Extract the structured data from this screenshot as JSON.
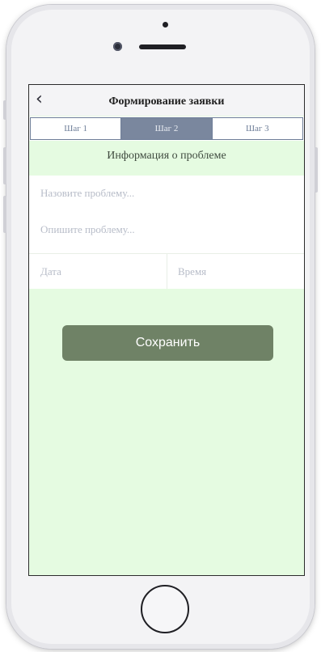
{
  "header": {
    "back_icon": "chevron-left-icon",
    "back_glyph": "‹",
    "title": "Формирование заявки"
  },
  "tabs": [
    {
      "label": "Шаг 1",
      "active": false
    },
    {
      "label": "Шаг 2",
      "active": true
    },
    {
      "label": "Шаг 3",
      "active": false
    }
  ],
  "section": {
    "title": "Информация о проблеме"
  },
  "form": {
    "problem_name_placeholder": "Назовите проблему...",
    "problem_desc_placeholder": "Опишите проблему...",
    "date_placeholder": "Дата",
    "time_placeholder": "Время"
  },
  "actions": {
    "save_label": "Сохранить"
  },
  "colors": {
    "background": "#e5fbe1",
    "tab_active": "#7a879e",
    "button": "#6f8266"
  }
}
